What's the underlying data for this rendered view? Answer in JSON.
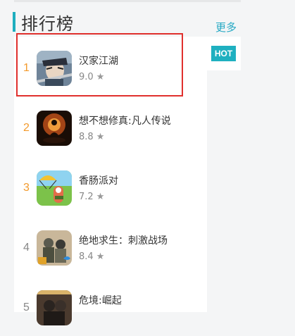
{
  "header": {
    "title": "排行榜",
    "more_label": "更多",
    "hot_badge": "HOT",
    "accent_color": "#1eaebf"
  },
  "rank_color_top": "#f39a2c",
  "rank_color_other": "#888888",
  "highlight_color": "#e0302d",
  "apps": [
    {
      "rank": "1",
      "name": "汉家江湖",
      "score": "9.0",
      "icon": "warrior-character-icon"
    },
    {
      "rank": "2",
      "name": "想不想修真:凡人传说",
      "score": "8.8",
      "icon": "meditating-figure-icon"
    },
    {
      "rank": "3",
      "name": "香肠派对",
      "score": "7.2",
      "icon": "parachute-sausage-icon"
    },
    {
      "rank": "4",
      "name": "绝地求生：刺激战场",
      "score": "8.4",
      "icon": "soldiers-icon"
    },
    {
      "rank": "5",
      "name": "危境:崛起",
      "score": "",
      "icon": "dark-warrior-icon"
    }
  ]
}
